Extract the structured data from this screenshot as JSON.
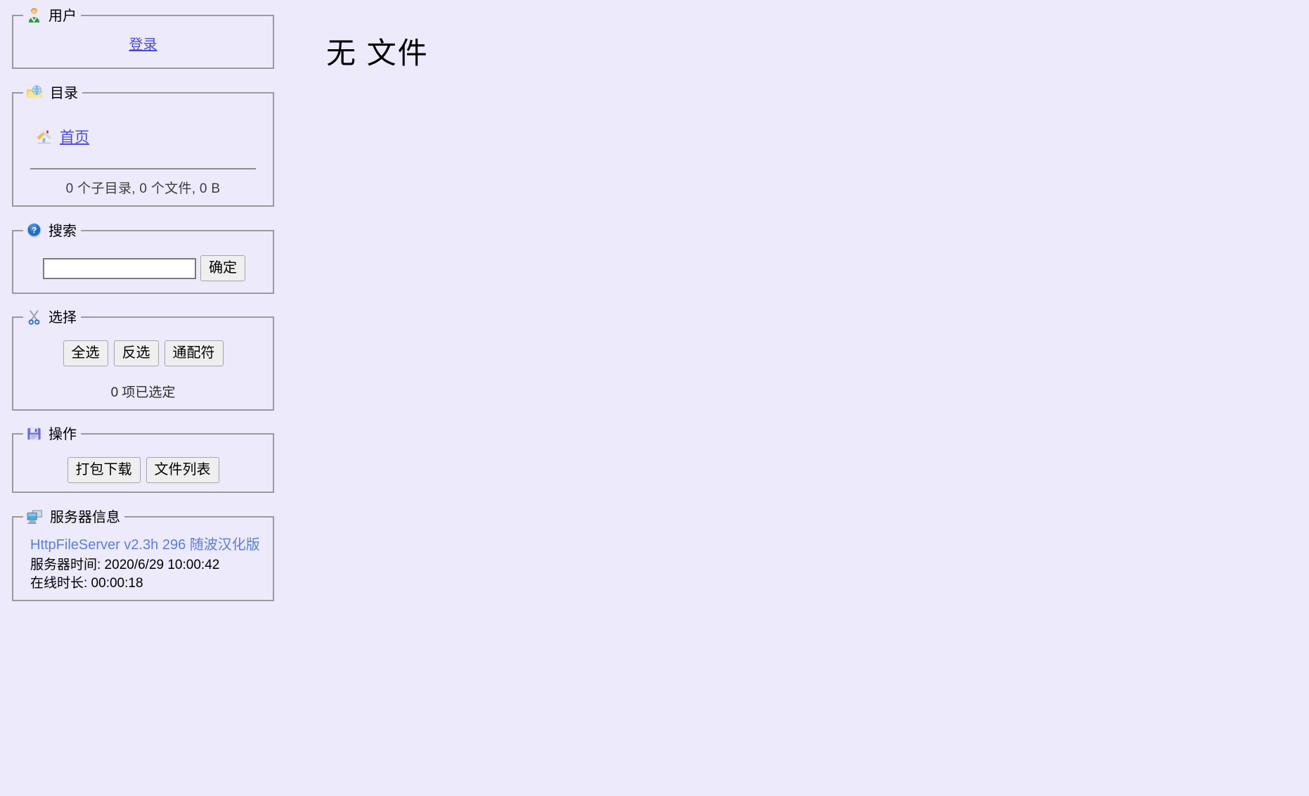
{
  "page": {
    "background": "#eceafb",
    "link_color": "#4a4ad6"
  },
  "sidebar": {
    "user_panel": {
      "icon": "user-icon",
      "legend": "用户",
      "login_link": "登录"
    },
    "folder_panel": {
      "icon": "folder-globe-icon",
      "legend": "目录",
      "home_icon": "house-icon",
      "home_link": "首页",
      "stats": "0 个子目录, 0 个文件, 0 B"
    },
    "search_panel": {
      "icon": "help-question-icon",
      "legend": "搜索",
      "input_value": "",
      "input_placeholder": "",
      "submit_label": "确定"
    },
    "select_panel": {
      "icon": "scissors-icon",
      "legend": "选择",
      "buttons": [
        {
          "label": "全选",
          "name": "select-all-button"
        },
        {
          "label": "反选",
          "name": "invert-selection-button"
        },
        {
          "label": "通配符",
          "name": "wildcard-button"
        }
      ],
      "selected_count": "0 项已选定"
    },
    "action_panel": {
      "icon": "floppy-disk-icon",
      "legend": "操作",
      "buttons": [
        {
          "label": "打包下载",
          "name": "archive-download-button"
        },
        {
          "label": "文件列表",
          "name": "file-list-button"
        }
      ]
    },
    "server_panel": {
      "icon": "server-computer-icon",
      "legend": "服务器信息",
      "version": "HttpFileServer v2.3h 296 随波汉化版",
      "version_color": "#5b7fd4",
      "server_time": "服务器时间: 2020/6/29 10:00:42",
      "uptime": "在线时长: 00:00:18"
    }
  },
  "main": {
    "title": "无 文件"
  }
}
